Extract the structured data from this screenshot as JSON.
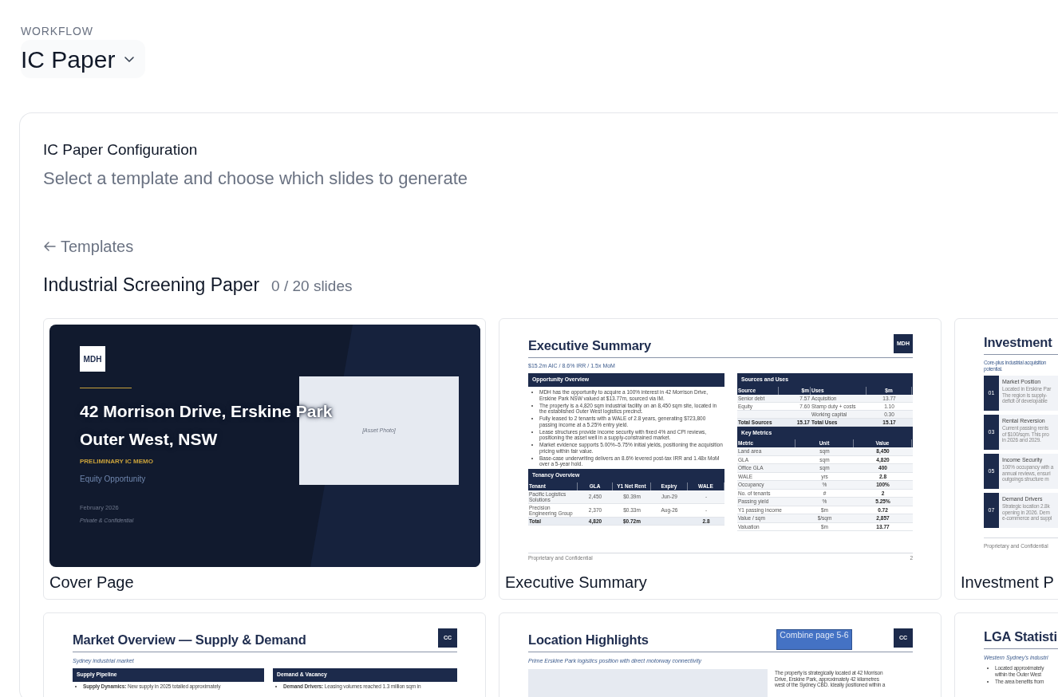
{
  "header": {
    "eyebrow": "WORKFLOW",
    "workflow": "IC Paper"
  },
  "config": {
    "title": "IC Paper Configuration",
    "subtitle": "Select a template and choose which slides to generate",
    "back": "Templates",
    "template_name": "Industrial Screening Paper",
    "slide_count": "0 / 20 slides"
  },
  "slides": [
    {
      "kind": "cover",
      "selected": false,
      "caption": "Cover Page",
      "logo": "MDH",
      "title_lines": [
        "42 Morrison Drive, Erskine Park",
        "Outer West, NSW"
      ],
      "label": "PRELIMINARY IC MEMO",
      "subtitle": "Equity Opportunity",
      "date": "February 2026",
      "note": "Private & Confidential",
      "photo_label": "[Asset Photo]"
    },
    {
      "kind": "summary",
      "selected": false,
      "caption": "Executive Summary",
      "title": "Executive Summary",
      "logo": "MDH",
      "subtitle": "$15.2m AIC / 8.6% IRR / 1.5x MoM",
      "overview": {
        "heading": "Opportunity Overview",
        "bullets": [
          "MDH has the opportunity to acquire a 100% interest in 42 Morrison Drive, Erskine Park NSW valued at $13.77m, sourced via IM.",
          "The property is a 4,820 sqm industrial facility on an 8,450 sqm site, located in the established Outer West logistics precinct.",
          "Fully leased to 2 tenants with a WALE of 2.8 years, generating $723,800 passing income at a 5.25% entry yield.",
          "Lease structures provide income security with fixed 4% and CPI reviews, positioning the asset well in a supply-constrained market.",
          "Market evidence supports 5.00%–5.75% initial yields, positioning the acquisition pricing within fair value.",
          "Base-case underwriting delivers an 8.6% levered post-tax IRR and 1.48x MoM over a 5-year hold."
        ]
      },
      "tenancy": {
        "heading": "Tenancy Overview",
        "columns": [
          "Tenant",
          "GLA",
          "Y1 Net Rent",
          "Expiry",
          "WALE"
        ],
        "rows": [
          {
            "total": false,
            "cells": [
              "Pacific Logistics Solutions",
              "2,450",
              "$0.39m",
              "Jun-29",
              "-"
            ]
          },
          {
            "total": false,
            "cells": [
              "Precision Engineering Group",
              "2,370",
              "$0.33m",
              "Aug-26",
              "-"
            ]
          },
          {
            "total": true,
            "cells": [
              "Total",
              "4,820",
              "$0.72m",
              null,
              "2.8"
            ]
          }
        ]
      },
      "sources_uses": {
        "heading": "Sources and Uses",
        "columns": [
          "Source",
          "$m",
          "Uses",
          "$m"
        ],
        "rows": [
          {
            "total": false,
            "cells": [
              "Senior debt",
              "7.57",
              "Acquisition",
              "13.77"
            ]
          },
          {
            "total": false,
            "cells": [
              "Equity",
              "7.60",
              "Stamp duty + costs",
              "1.10"
            ]
          },
          {
            "total": false,
            "cells": [
              null,
              null,
              "Working capital",
              "0.30"
            ]
          },
          {
            "total": true,
            "cells": [
              "Total Sources",
              "15.17",
              "Total Uses",
              "15.17"
            ]
          }
        ]
      },
      "key_metrics": {
        "heading": "Key Metrics",
        "columns": [
          "Metric",
          "Unit",
          "Value"
        ],
        "rows": [
          [
            "Land area",
            "sqm",
            "8,450"
          ],
          [
            "GLA",
            "sqm",
            "4,820"
          ],
          [
            "Office GLA",
            "sqm",
            "400"
          ],
          [
            "WALE",
            "yrs",
            "2.8"
          ],
          [
            "Occupancy",
            "%",
            "100%"
          ],
          [
            "No. of tenants",
            "#",
            "2"
          ],
          [
            "Passing yield",
            "%",
            "5.25%"
          ],
          [
            "Y1 passing income",
            "$m",
            "0.72"
          ],
          [
            "Value / sqm",
            "$/sqm",
            "2,857"
          ],
          [
            "Valuation",
            "$m",
            "13.77"
          ]
        ]
      },
      "footer": "Proprietary and Confidential",
      "page_number": "2"
    },
    {
      "kind": "pillars",
      "selected": false,
      "caption": "Investment P",
      "title": "Investment",
      "subtitle_lines": [
        "Core-plus industrial acquisition",
        "potential."
      ],
      "items": [
        {
          "number": "01",
          "heading": "Market Position",
          "lines": [
            "Located in Erskine Par",
            "The region is supply-",
            "deficit of developable"
          ]
        },
        {
          "number": "03",
          "heading": "Rental Reversion",
          "lines": [
            "Current passing rents",
            "of $100/sqm. This pro",
            "in 2026 and 2029."
          ]
        },
        {
          "number": "05",
          "heading": "Income Security",
          "lines": [
            "100% occupancy with a",
            "annual reviews, ensuri",
            "outgoings structure m"
          ]
        },
        {
          "number": "07",
          "heading": "Demand Drivers",
          "lines": [
            "Strategic location 2.8k",
            "opening in 2026. Dem",
            "e-commerce and suppl"
          ]
        }
      ],
      "footer": "Proprietary and Confidential"
    },
    {
      "kind": "two_panel",
      "selected": false,
      "title": "Market Overview — Supply & Demand",
      "logo": "CC",
      "subtitle": "Sydney industrial market",
      "panels": [
        {
          "heading": "Supply Pipeline",
          "bullet": "**Supply Dynamics:** New supply in 2025 totalled approximately"
        },
        {
          "heading": "Demand & Vacancy",
          "bullet": "**Demand Drivers:** Leasing volumes reached 1.3 million sqm in"
        }
      ]
    },
    {
      "kind": "location",
      "selected": false,
      "title": "Location Highlights",
      "logo": "CC",
      "sticky_note": "Combine page 5-6",
      "subtitle": "Prime Erskine Park logistics position with direct motorway connectivity",
      "paragraph_lines": [
        "The property is strategically located at 42 Morrison",
        "Drive, Erskine Park, approximately 42 kilometres",
        "west of the Sydney CBD. Ideally positioned within a"
      ]
    },
    {
      "kind": "bullets",
      "selected": false,
      "title": "LGA Statisti",
      "subtitle": "Western Sydney's industri",
      "bullets": [
        [
          "Located approximately",
          "within the Outer West"
        ],
        [
          "The area benefits from"
        ]
      ]
    }
  ]
}
